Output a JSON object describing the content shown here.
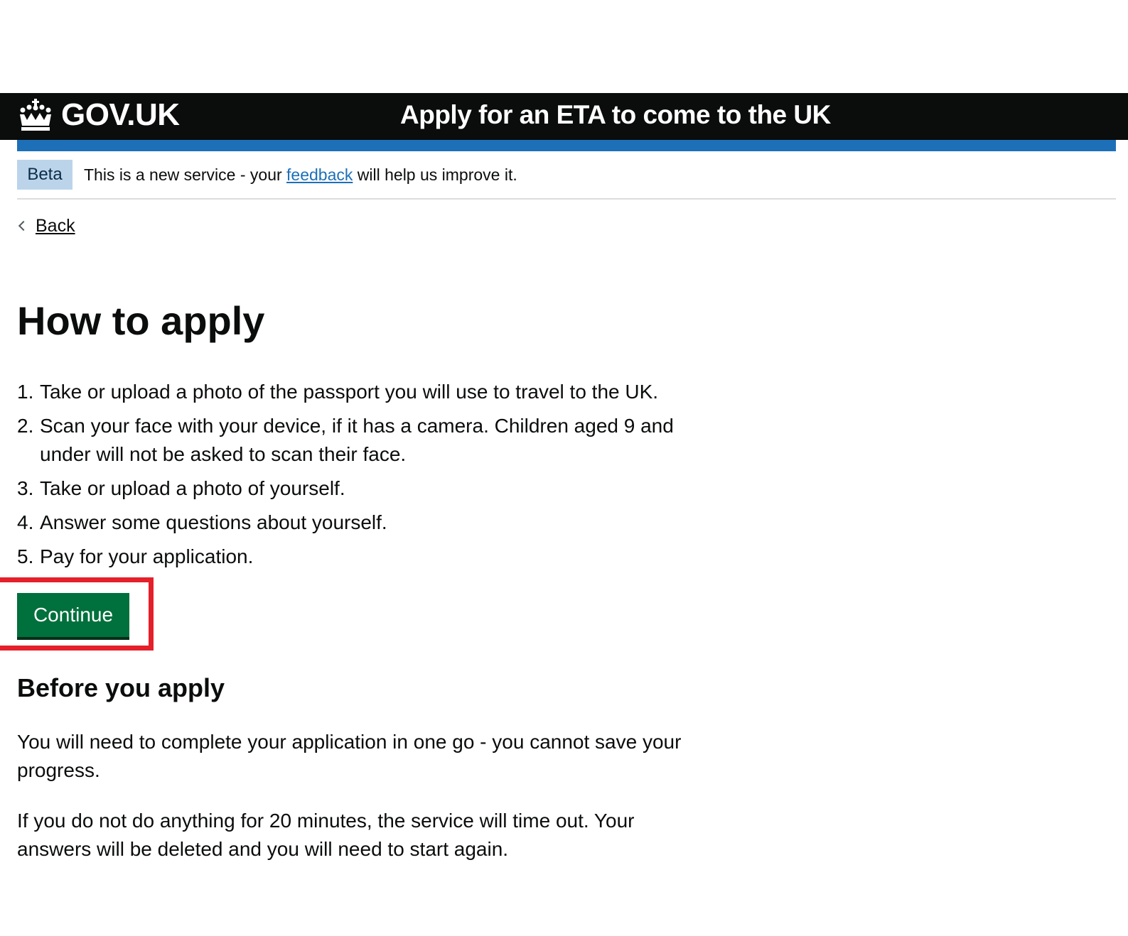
{
  "header": {
    "logo_text": "GOV.UK",
    "logo_icon": "crown-icon",
    "service_name": "Apply for an ETA to come to the UK"
  },
  "phase_banner": {
    "tag": "Beta",
    "text_before": "This is a new service - your ",
    "link_text": "feedback",
    "text_after": " will help us improve it."
  },
  "back_link": {
    "label": "Back",
    "icon": "chevron-left-icon"
  },
  "main": {
    "title": "How to apply",
    "steps": [
      {
        "number": "1.",
        "text": "Take or upload a photo of the passport you will use to travel to the UK."
      },
      {
        "number": "2.",
        "text": "Scan your face with your device, if it has a camera. Children aged 9 and under will not be asked to scan their face."
      },
      {
        "number": "3.",
        "text": "Take or upload a photo of yourself."
      },
      {
        "number": "4.",
        "text": "Answer some questions about yourself."
      },
      {
        "number": "5.",
        "text": "Pay for your application."
      }
    ],
    "continue_label": "Continue",
    "before_heading": "Before you apply",
    "paragraphs": [
      "You will need to complete your application in one go - you cannot save your progress.",
      "If you do not do anything for 20 minutes, the service will time out. Your answers will be deleted and you will need to start again."
    ]
  },
  "colors": {
    "header_bg": "#0b0c0c",
    "blue_bar": "#1d70b8",
    "beta_tag_bg": "#bbd4ea",
    "link": "#1d70b8",
    "button_green": "#00703c",
    "highlight_red": "#e4202b"
  }
}
